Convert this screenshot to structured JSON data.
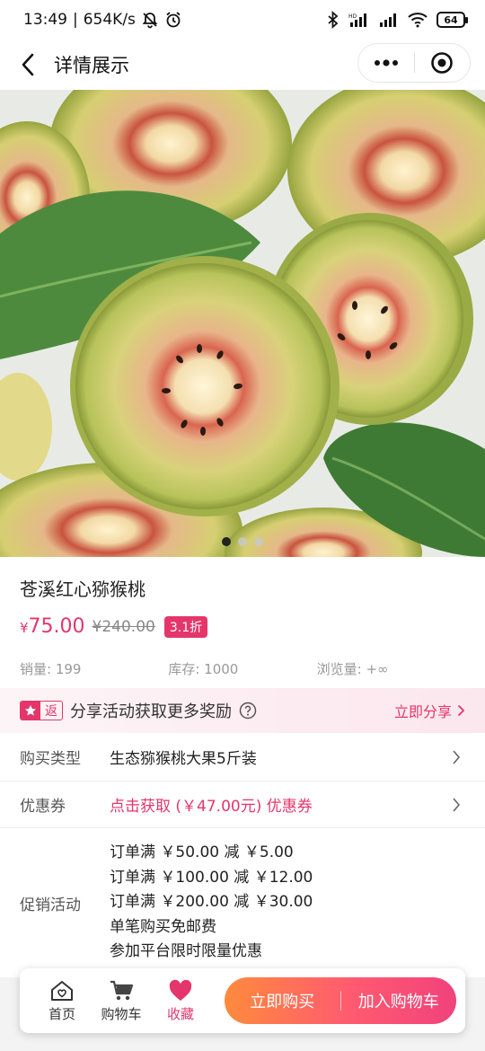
{
  "status_bar": {
    "time": "13:49",
    "net_speed": "654K/s",
    "battery": "64"
  },
  "nav": {
    "title": "详情展示"
  },
  "gallery": {
    "image_count": 3,
    "active_index": 0
  },
  "product": {
    "name": "苍溪红心猕猴桃",
    "currency": "¥",
    "price": "75.00",
    "original_price": "¥240.00",
    "discount": "3.1折",
    "sales": "销量: 199",
    "stock": "库存: 1000",
    "views": "浏览量: +∞"
  },
  "share": {
    "tag": "返",
    "text": "分享活动获取更多奖励",
    "link": "立即分享"
  },
  "purchase_type": {
    "label": "购买类型",
    "value": "生态猕猴桃大果5斤装"
  },
  "coupon": {
    "label": "优惠券",
    "value": "点击获取 (￥47.00元) 优惠券"
  },
  "promotions": {
    "label": "促销活动",
    "items": [
      "订单满 ￥50.00 减 ￥5.00",
      "订单满 ￥100.00 减 ￥12.00",
      "订单满 ￥200.00 减 ￥30.00",
      "单笔购买免邮费",
      "参加平台限时限量优惠"
    ]
  },
  "bottom_bar": {
    "home": "首页",
    "cart": "购物车",
    "favorite": "收藏",
    "buy_now": "立即购买",
    "add_to_cart": "加入购物车"
  },
  "colors": {
    "accent": "#e4366a",
    "gradient_start": "#ff8a3d",
    "gradient_end": "#f0427c"
  }
}
